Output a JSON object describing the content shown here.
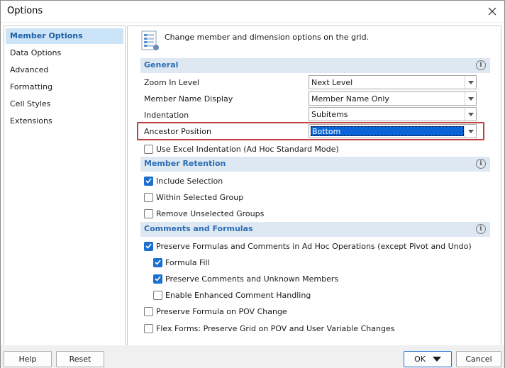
{
  "window": {
    "title": "Options"
  },
  "sidebar": {
    "items": [
      {
        "label": "Member Options"
      },
      {
        "label": "Data Options"
      },
      {
        "label": "Advanced"
      },
      {
        "label": "Formatting"
      },
      {
        "label": "Cell Styles"
      },
      {
        "label": "Extensions"
      }
    ]
  },
  "header": {
    "text": "Change member and dimension options on the grid."
  },
  "sections": {
    "general": {
      "title": "General"
    },
    "retention": {
      "title": "Member Retention"
    },
    "comments": {
      "title": "Comments and Formulas"
    }
  },
  "general": {
    "zoom_label": "Zoom In Level",
    "zoom_value": "Next Level",
    "display_label": "Member Name Display",
    "display_value": "Member Name Only",
    "indent_label": "Indentation",
    "indent_value": "Subitems",
    "ancestor_label": "Ancestor Position",
    "ancestor_value": "Bottom",
    "excel_indent_label": "Use Excel Indentation (Ad Hoc Standard Mode)",
    "excel_indent_checked": false
  },
  "retention": {
    "include_label": "Include Selection",
    "include_checked": true,
    "within_label": "Within Selected Group",
    "within_checked": false,
    "remove_label": "Remove Unselected Groups",
    "remove_checked": false
  },
  "comments": {
    "preserve_label": "Preserve Formulas and Comments in Ad Hoc Operations (except Pivot and Undo)",
    "preserve_checked": true,
    "fill_label": "Formula Fill",
    "fill_checked": true,
    "unknown_label": "Preserve Comments and Unknown Members",
    "unknown_checked": true,
    "enhanced_label": "Enable Enhanced Comment Handling",
    "enhanced_checked": false,
    "pov_label": "Preserve Formula on POV Change",
    "pov_checked": false,
    "flex_label": "Flex Forms: Preserve Grid on POV and User Variable Changes",
    "flex_checked": false
  },
  "footer": {
    "help_label": "Help",
    "reset_label": "Reset",
    "ok_label": "OK",
    "cancel_label": "Cancel"
  },
  "colors": {
    "accent": "#2c6db5",
    "section_bg": "#dde8f2",
    "selected_bg": "#cce4f7",
    "checkbox_checked": "#1a6fd0",
    "highlight_border": "#c0433f"
  }
}
